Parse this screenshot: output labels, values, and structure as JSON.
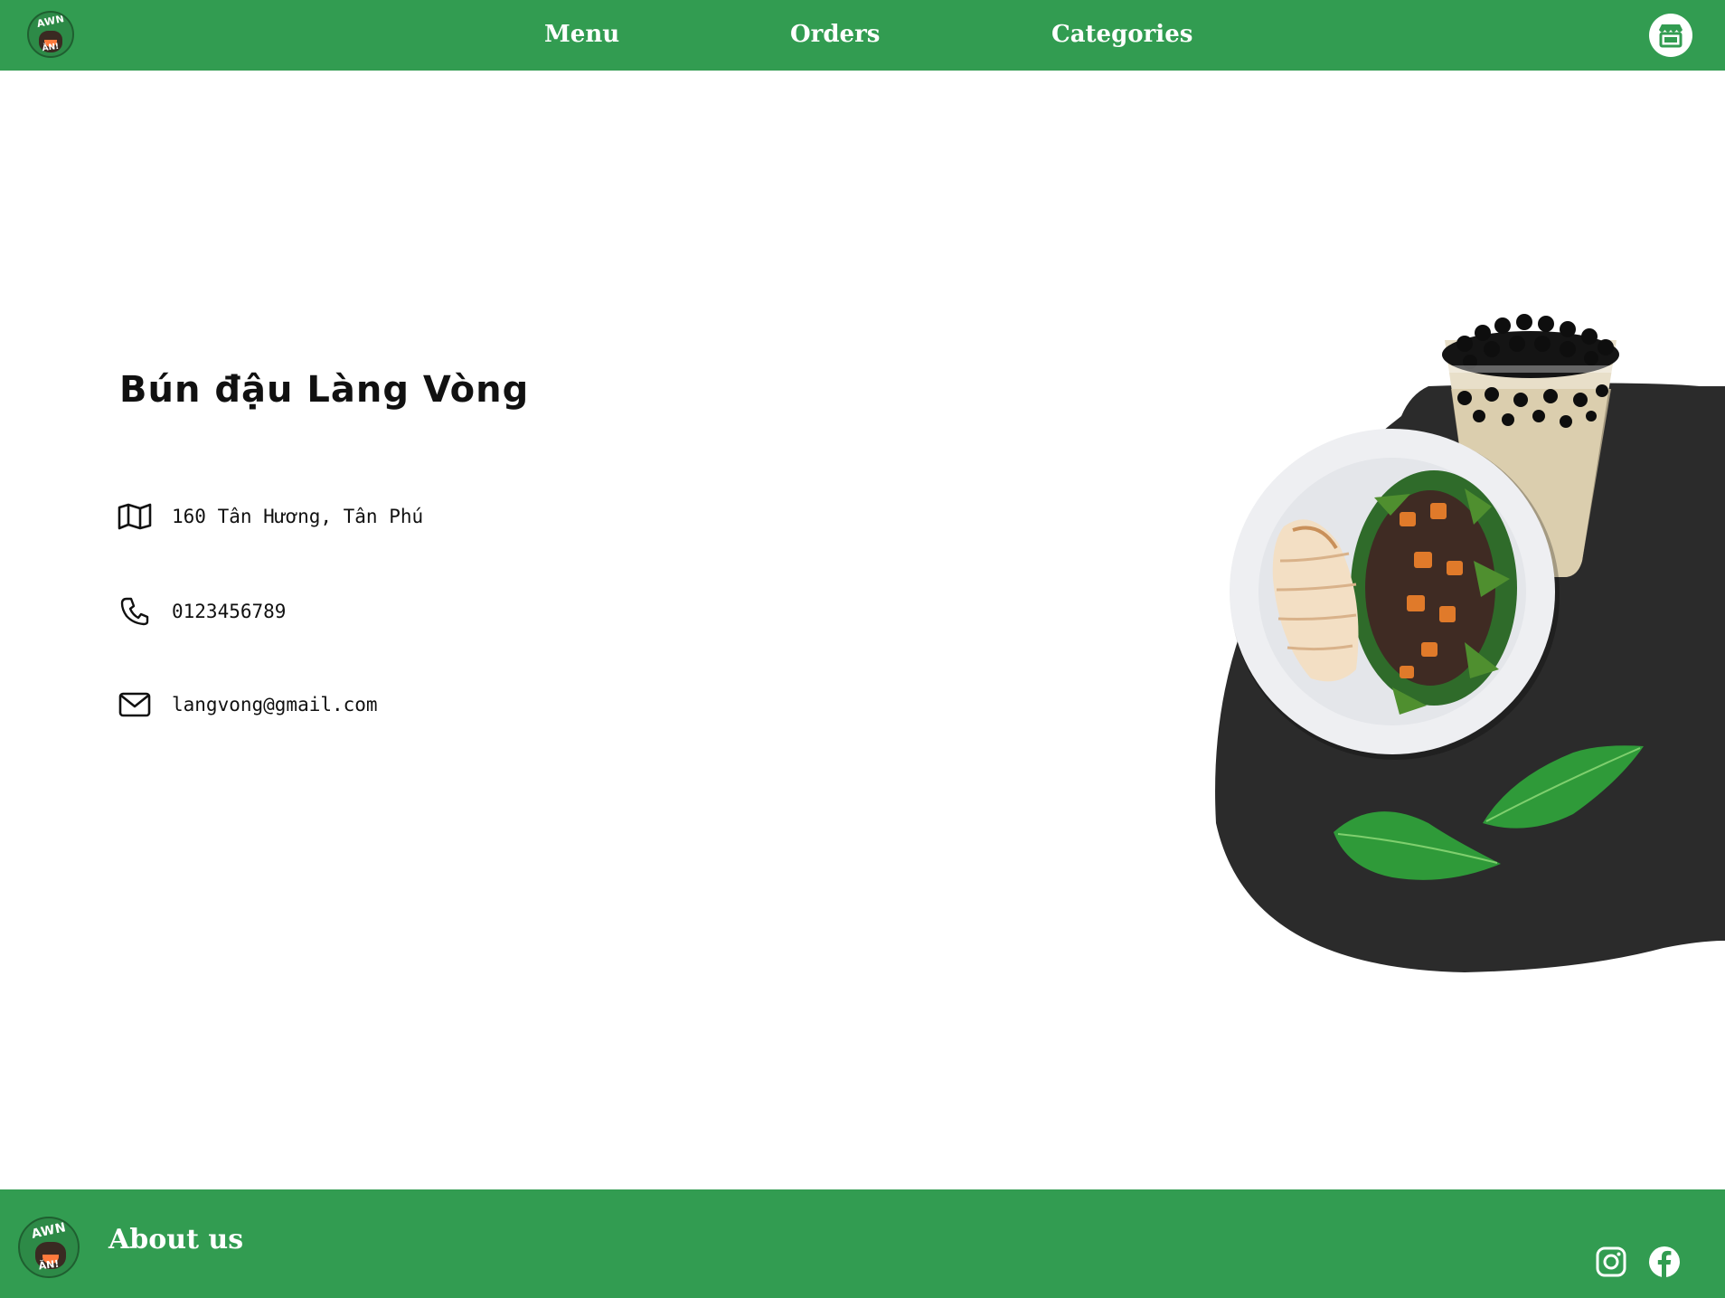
{
  "header": {
    "logo_text_top": "AWN",
    "logo_text_bottom": "ĂN!",
    "nav": [
      {
        "label": "Menu"
      },
      {
        "label": "Orders"
      },
      {
        "label": "Categories"
      }
    ],
    "store_icon": "storefront-icon"
  },
  "shop": {
    "name": "Bún đậu Làng Vòng",
    "address": "160 Tân Hương, Tân Phú",
    "phone": "0123456789",
    "email": "langvong@gmail.com",
    "icons": [
      "map-icon",
      "phone-icon",
      "mail-icon"
    ]
  },
  "hero": {
    "icons": [
      "bubble-tea-image",
      "salad-plate-image",
      "leaf-image"
    ]
  },
  "footer": {
    "logo_text_top": "AWN",
    "logo_text_bottom": "ĂN!",
    "about_label": "About us",
    "social_icons": [
      "instagram-icon",
      "facebook-icon"
    ]
  },
  "colors": {
    "brand_green": "#329c51",
    "blob_dark": "#2b2b2b",
    "text": "#111111"
  }
}
